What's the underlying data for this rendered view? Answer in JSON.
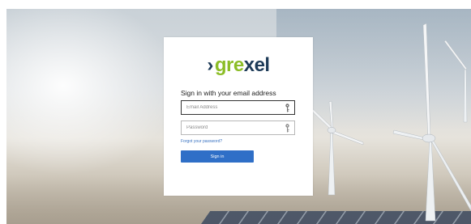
{
  "logo": {
    "chevron": "›",
    "part_green": "gre",
    "part_navy": "xel"
  },
  "login": {
    "heading": "Sign in with your email address",
    "email": {
      "placeholder": "Email Address",
      "value": ""
    },
    "password": {
      "placeholder": "Password",
      "value": ""
    },
    "forgot_link": "Forgot your password?",
    "signin_button": "Sign in"
  },
  "icons": {
    "email_field": "key-icon",
    "password_field": "key-icon"
  },
  "colors": {
    "logo_green": "#8cbd27",
    "logo_navy": "#1e3b58",
    "button": "#2f6fc7",
    "link": "#3a73c2"
  }
}
